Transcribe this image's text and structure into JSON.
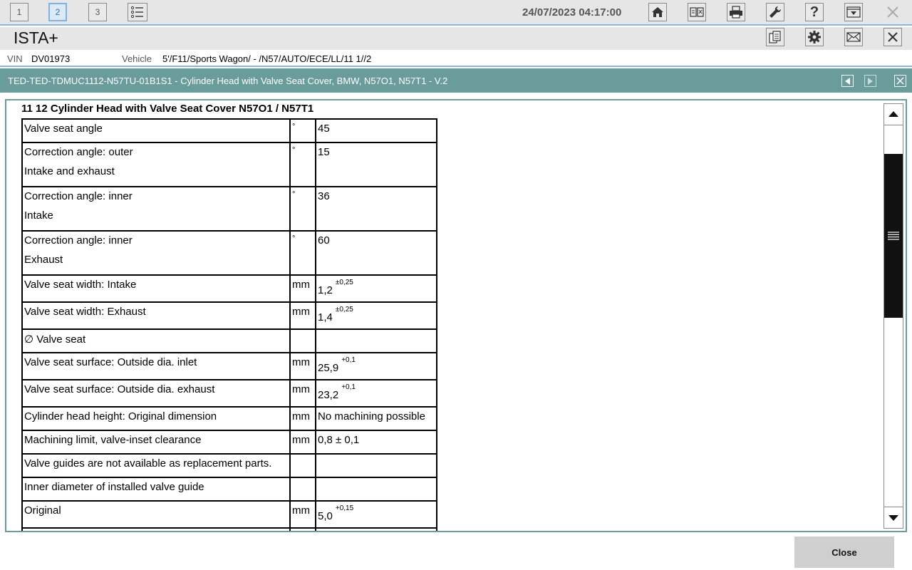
{
  "toolbar": {
    "workspaces": [
      "1",
      "2",
      "3"
    ],
    "active_workspace": "2",
    "datetime": "24/07/2023 04:17:00"
  },
  "app": {
    "title": "ISTA+"
  },
  "vehicle": {
    "vin_label": "VIN",
    "vin": "DV01973",
    "vehicle_label": "Vehicle",
    "vehicle": "5'/F11/Sports Wagon/ - /N57/AUTO/ECE/LL/11 1//2"
  },
  "document": {
    "title": "TED-TED-TDMUC1112-N57TU-01B1S1 - Cylinder Head with Valve Seat Cover, BMW, N57O1, N57T1 - V.2",
    "section_title": "11 12 Cylinder Head with Valve Seat Cover N57O1 / N57T1",
    "rows": [
      {
        "label": "Valve seat angle",
        "label2": "",
        "unit": "°",
        "value": "45",
        "sup": ""
      },
      {
        "label": "Correction angle: outer",
        "label2": "Intake and exhaust",
        "unit": "°",
        "value": "15",
        "sup": ""
      },
      {
        "label": "Correction angle: inner",
        "label2": "Intake",
        "unit": "°",
        "value": "36",
        "sup": ""
      },
      {
        "label": "Correction angle: inner",
        "label2": "Exhaust",
        "unit": "°",
        "value": "60",
        "sup": ""
      },
      {
        "label": "Valve seat width: Intake",
        "label2": "",
        "unit": "mm",
        "value": "1,2",
        "sup": "±0,25"
      },
      {
        "label": "Valve seat width: Exhaust",
        "label2": "",
        "unit": "mm",
        "value": "1,4",
        "sup": "±0,25"
      },
      {
        "label": "∅ Valve seat",
        "label2": "",
        "unit": "",
        "value": "",
        "sup": ""
      },
      {
        "label": "Valve seat surface: Outside dia. inlet",
        "label2": "",
        "unit": "mm",
        "value": "25,9",
        "sup": "+0,1"
      },
      {
        "label": "Valve seat surface: Outside dia. exhaust",
        "label2": "",
        "unit": "mm",
        "value": "23,2",
        "sup": "+0,1"
      },
      {
        "label": "Cylinder head height: Original dimension",
        "label2": "",
        "unit": "mm",
        "value": "No machining possible",
        "sup": ""
      },
      {
        "label": "Machining limit, valve-inset clearance",
        "label2": "",
        "unit": "mm",
        "value": "0,8 ± 0,1",
        "sup": ""
      },
      {
        "label": "Valve guides are not available as replacement parts.",
        "label2": "",
        "unit": "",
        "value": "",
        "sup": ""
      },
      {
        "label": "Inner diameter of installed valve guide",
        "label2": "",
        "unit": "",
        "value": "",
        "sup": ""
      },
      {
        "label": "Original",
        "label2": "",
        "unit": "mm",
        "value": "5,0",
        "sup": "+0,15"
      }
    ]
  },
  "footer": {
    "close_label": "Close"
  }
}
